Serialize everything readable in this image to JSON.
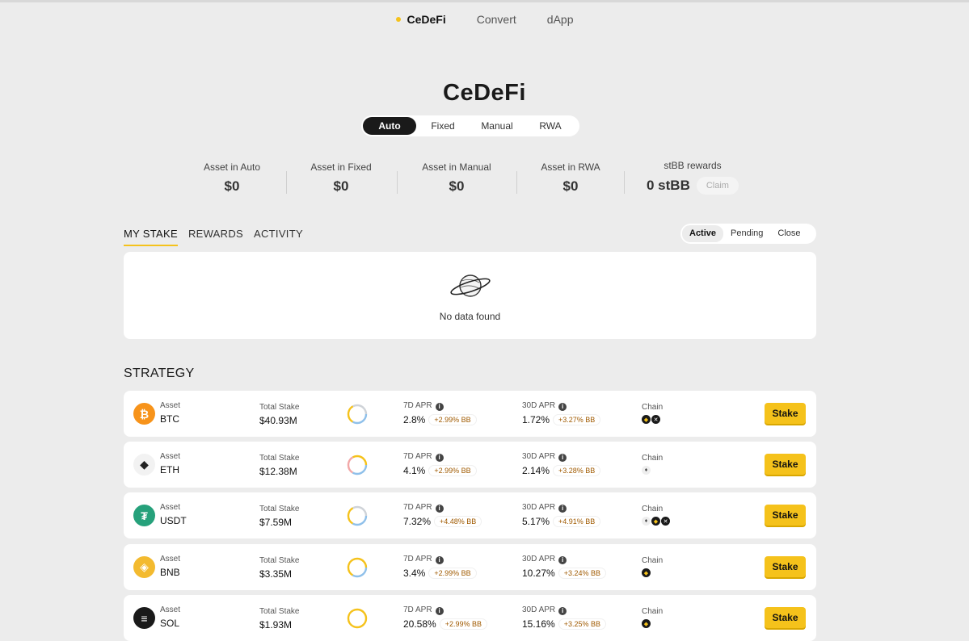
{
  "topnav": {
    "items": [
      "CeDeFi",
      "Convert",
      "dApp"
    ]
  },
  "page": {
    "title": "CeDeFi"
  },
  "segment": {
    "items": [
      "Auto",
      "Fixed",
      "Manual",
      "RWA"
    ]
  },
  "stats": [
    {
      "label": "Asset in Auto",
      "value": "$0"
    },
    {
      "label": "Asset in Fixed",
      "value": "$0"
    },
    {
      "label": "Asset in Manual",
      "value": "$0"
    },
    {
      "label": "Asset in RWA",
      "value": "$0"
    },
    {
      "label": "stBB rewards",
      "value": "0 stBB",
      "button": "Claim"
    }
  ],
  "stake_tabs": [
    "MY STAKE",
    "REWARDS",
    "ACTIVITY"
  ],
  "status_tabs": [
    "Active",
    "Pending",
    "Close"
  ],
  "empty": {
    "message": "No data found"
  },
  "strategy": {
    "title": "STRATEGY",
    "labels": {
      "asset": "Asset",
      "total": "Total Stake",
      "apr7": "7D APR",
      "apr30": "30D APR",
      "chain": "Chain",
      "stake": "Stake"
    },
    "rows": [
      {
        "asset": "BTC",
        "total": "$40.93M",
        "apr7": "2.8%",
        "apr7_bb": "+2.99% BB",
        "apr30": "1.72%",
        "apr30_bb": "+3.27% BB",
        "color": "#f7931a",
        "glyph": "₿",
        "chains": [
          "bnb-icon",
          "x-icon"
        ]
      },
      {
        "asset": "ETH",
        "total": "$12.38M",
        "apr7": "4.1%",
        "apr7_bb": "+2.99% BB",
        "apr30": "2.14%",
        "apr30_bb": "+3.28% BB",
        "color": "#f2f2f2",
        "glyph": "◆",
        "chains": [
          "eth-icon"
        ]
      },
      {
        "asset": "USDT",
        "total": "$7.59M",
        "apr7": "7.32%",
        "apr7_bb": "+4.48% BB",
        "apr30": "5.17%",
        "apr30_bb": "+4.91% BB",
        "color": "#26a17b",
        "glyph": "₮",
        "chains": [
          "eth-icon",
          "bnb-icon",
          "x-icon"
        ]
      },
      {
        "asset": "BNB",
        "total": "$3.35M",
        "apr7": "3.4%",
        "apr7_bb": "+2.99% BB",
        "apr30": "10.27%",
        "apr30_bb": "+3.24% BB",
        "color": "#f3ba2f",
        "glyph": "◈",
        "chains": [
          "bnb-icon"
        ]
      },
      {
        "asset": "SOL",
        "total": "$1.93M",
        "apr7": "20.58%",
        "apr7_bb": "+2.99% BB",
        "apr30": "15.16%",
        "apr30_bb": "+3.25% BB",
        "color": "#1a1a1a",
        "glyph": "≡",
        "chains": [
          "bnb-icon"
        ]
      }
    ]
  }
}
